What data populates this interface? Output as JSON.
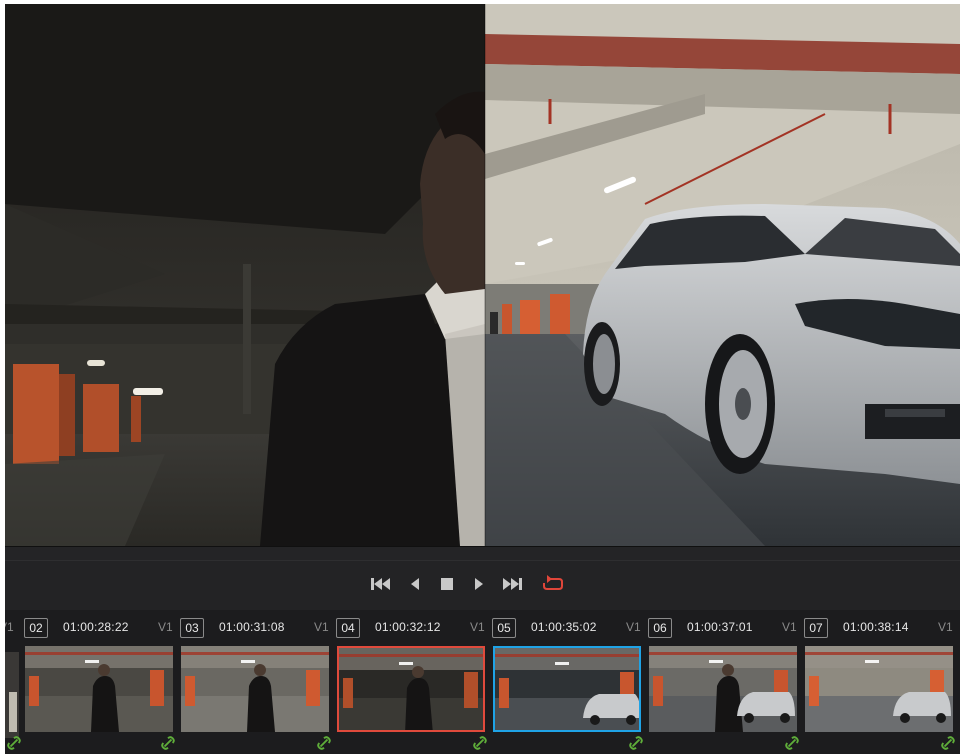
{
  "viewer": {
    "description_icon_left": "viewer-split-left-image",
    "description_icon_right": "viewer-split-right-image"
  },
  "transport": {
    "buttons": [
      {
        "name": "jump-to-start-button",
        "icon": "skip-back-icon"
      },
      {
        "name": "play-reverse-button",
        "icon": "play-reverse-icon"
      },
      {
        "name": "stop-button",
        "icon": "stop-icon"
      },
      {
        "name": "play-forward-button",
        "icon": "play-icon"
      },
      {
        "name": "jump-to-end-button",
        "icon": "skip-forward-icon"
      },
      {
        "name": "loop-button",
        "icon": "loop-icon",
        "color": "#e0463a"
      }
    ]
  },
  "clips": {
    "leading_track": "V1",
    "items": [
      {
        "number": "02",
        "timecode": "01:00:28:22",
        "track": "V1",
        "state": "normal"
      },
      {
        "number": "03",
        "timecode": "01:00:31:08",
        "track": "V1",
        "state": "normal"
      },
      {
        "number": "04",
        "timecode": "01:00:32:12",
        "track": "V1",
        "state": "selected-red",
        "color": "#e04a3c"
      },
      {
        "number": "05",
        "timecode": "01:00:35:02",
        "track": "V1",
        "state": "selected-blue",
        "color": "#1fa3e6"
      },
      {
        "number": "06",
        "timecode": "01:00:37:01",
        "track": "V1",
        "state": "normal"
      },
      {
        "number": "07",
        "timecode": "01:00:38:14",
        "track": "V1",
        "state": "normal"
      }
    ]
  },
  "colors": {
    "accent_red": "#e04a3c",
    "accent_blue": "#1fa3e6",
    "link_green": "#5fae3a",
    "panel": "#1c1c1e"
  }
}
